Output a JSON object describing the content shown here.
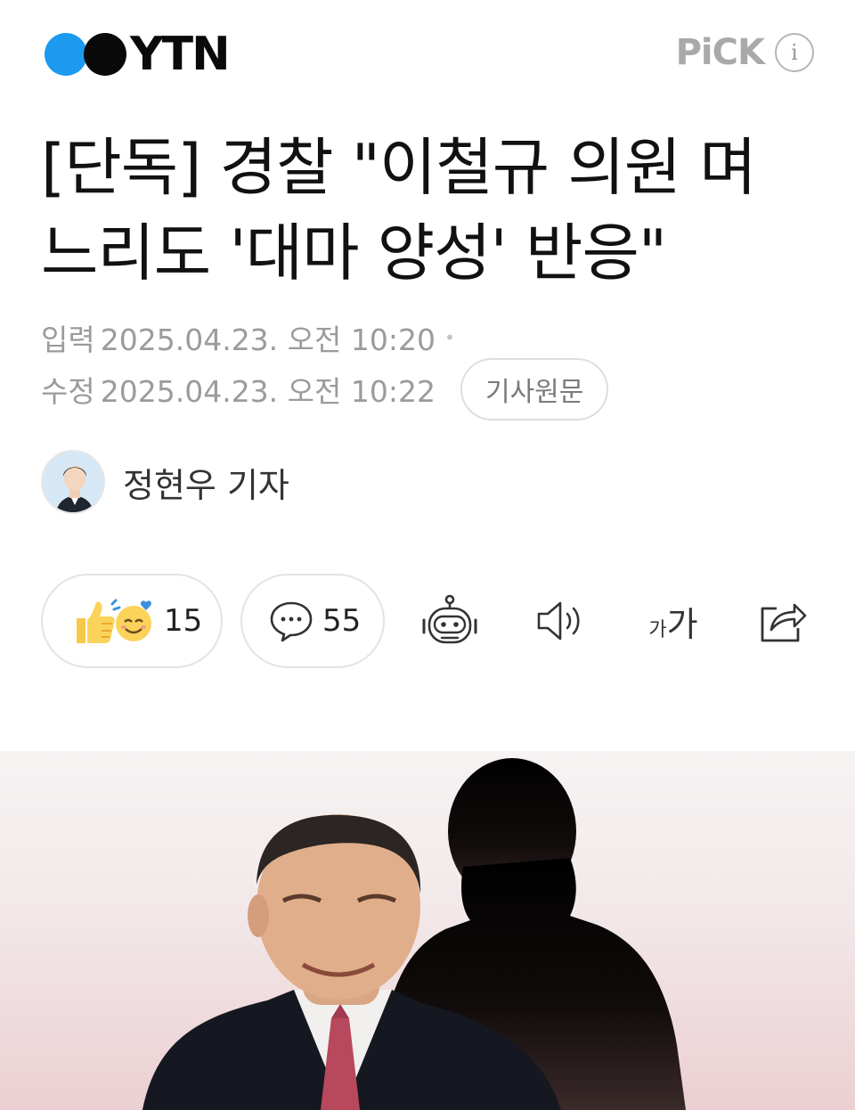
{
  "header": {
    "logo_text": "YTN",
    "pick_label": "PiCK",
    "info_label": "i"
  },
  "article": {
    "title_line1": "[단독] 경찰 \"이철규 의원 며",
    "title_line2": "느리도 '대마 양성' 반응\"",
    "input_label": "입력",
    "input_datetime": "2025.04.23. 오전 10:20",
    "bullet": "•",
    "modified_label": "수정",
    "modified_datetime": "2025.04.23. 오전 10:22",
    "original_button": "기사원문"
  },
  "reporter": {
    "name": "정현우 기자"
  },
  "actions": {
    "reaction_count": "15",
    "comment_count": "55",
    "font_small": "가",
    "font_big": "가"
  },
  "colors": {
    "logo_blue": "#1b9af0",
    "text_primary": "#111111",
    "text_meta": "#9b9b9b",
    "pill_border": "#e3e3e3"
  }
}
